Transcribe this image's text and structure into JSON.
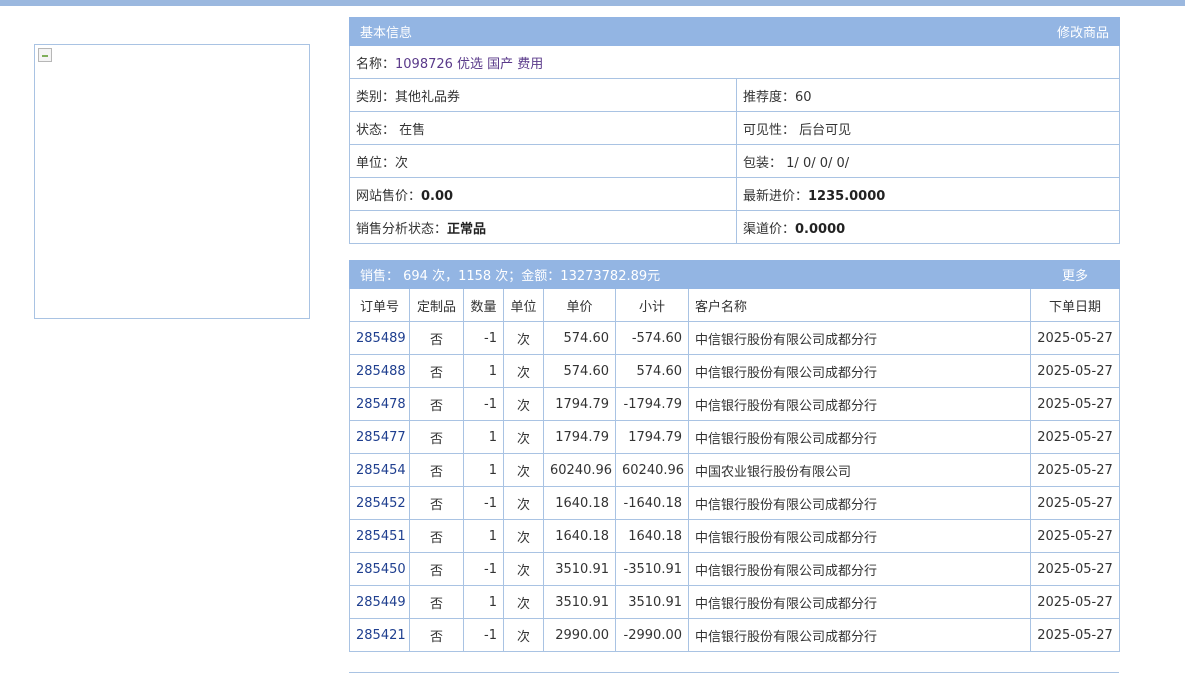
{
  "basic_info": {
    "section_title": "基本信息",
    "edit_link": "修改商品",
    "name_label": "名称：",
    "name_value": "1098726 优选 国产 费用",
    "category_label": "类别：",
    "category_value": "其他礼品券",
    "recommend_label": "推荐度：",
    "recommend_value": "60",
    "status_label": "状态：",
    "status_value": "在售",
    "visibility_label": "可见性：",
    "visibility_value": "后台可见",
    "unit_label": "单位：",
    "unit_value": "次",
    "package_label": "包装：",
    "package_value": "1/ 0/ 0/ 0/",
    "site_price_label": "网站售价：",
    "site_price_value": "0.00",
    "latest_cost_label": "最新进价：",
    "latest_cost_value": "1235.0000",
    "sales_status_label": "销售分析状态：",
    "sales_status_value": "正常品",
    "channel_price_label": "渠道价：",
    "channel_price_value": "0.0000"
  },
  "sales": {
    "summary": "销售：  694 次，1158 次；金额：13273782.89元",
    "more_link": "更多",
    "columns": [
      "订单号",
      "定制品",
      "数量",
      "单位",
      "单价",
      "小计",
      "客户名称",
      "下单日期"
    ],
    "rows": [
      {
        "order": "285489",
        "custom": "否",
        "qty": "-1",
        "unit": "次",
        "price": "574.60",
        "subtotal": "-574.60",
        "customer": "中信银行股份有限公司成都分行",
        "date": "2025-05-27"
      },
      {
        "order": "285488",
        "custom": "否",
        "qty": "1",
        "unit": "次",
        "price": "574.60",
        "subtotal": "574.60",
        "customer": "中信银行股份有限公司成都分行",
        "date": "2025-05-27"
      },
      {
        "order": "285478",
        "custom": "否",
        "qty": "-1",
        "unit": "次",
        "price": "1794.79",
        "subtotal": "-1794.79",
        "customer": "中信银行股份有限公司成都分行",
        "date": "2025-05-27"
      },
      {
        "order": "285477",
        "custom": "否",
        "qty": "1",
        "unit": "次",
        "price": "1794.79",
        "subtotal": "1794.79",
        "customer": "中信银行股份有限公司成都分行",
        "date": "2025-05-27"
      },
      {
        "order": "285454",
        "custom": "否",
        "qty": "1",
        "unit": "次",
        "price": "60240.96",
        "subtotal": "60240.96",
        "customer": "中国农业银行股份有限公司",
        "date": "2025-05-27"
      },
      {
        "order": "285452",
        "custom": "否",
        "qty": "-1",
        "unit": "次",
        "price": "1640.18",
        "subtotal": "-1640.18",
        "customer": "中信银行股份有限公司成都分行",
        "date": "2025-05-27"
      },
      {
        "order": "285451",
        "custom": "否",
        "qty": "1",
        "unit": "次",
        "price": "1640.18",
        "subtotal": "1640.18",
        "customer": "中信银行股份有限公司成都分行",
        "date": "2025-05-27"
      },
      {
        "order": "285450",
        "custom": "否",
        "qty": "-1",
        "unit": "次",
        "price": "3510.91",
        "subtotal": "-3510.91",
        "customer": "中信银行股份有限公司成都分行",
        "date": "2025-05-27"
      },
      {
        "order": "285449",
        "custom": "否",
        "qty": "1",
        "unit": "次",
        "price": "3510.91",
        "subtotal": "3510.91",
        "customer": "中信银行股份有限公司成都分行",
        "date": "2025-05-27"
      },
      {
        "order": "285421",
        "custom": "否",
        "qty": "-1",
        "unit": "次",
        "price": "2990.00",
        "subtotal": "-2990.00",
        "customer": "中信银行股份有限公司成都分行",
        "date": "2025-05-27"
      }
    ]
  }
}
